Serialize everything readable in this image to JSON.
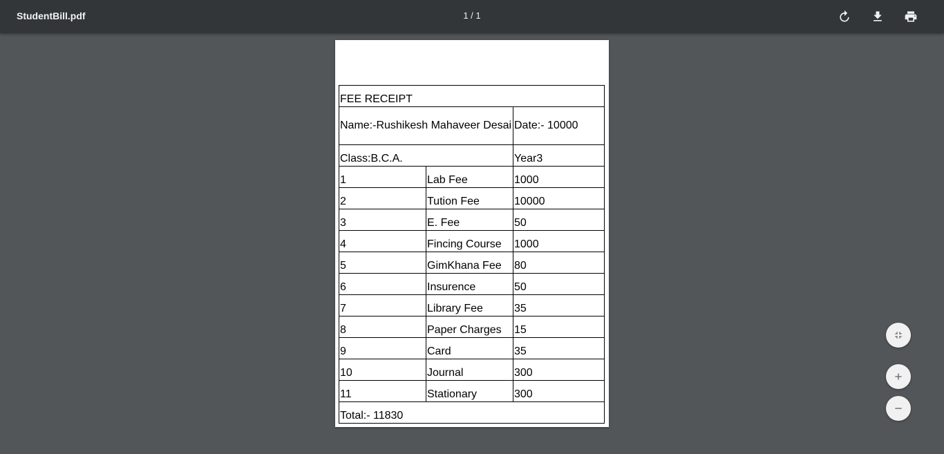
{
  "toolbar": {
    "file_name": "StudentBill.pdf",
    "page_indicator": "1 / 1",
    "icons": {
      "rotate": "rotate-icon",
      "download": "download-icon",
      "print": "print-icon"
    }
  },
  "receipt": {
    "title": "FEE RECEIPT",
    "name": "Name:-Rushikesh Mahaveer Desai",
    "date": "Date:- 10000",
    "class": "Class:B.C.A.",
    "year": "Year3",
    "items": [
      {
        "no": "1",
        "name": "Lab Fee",
        "amount": "1000"
      },
      {
        "no": "2",
        "name": "Tution Fee",
        "amount": "10000"
      },
      {
        "no": "3",
        "name": "E. Fee",
        "amount": "50"
      },
      {
        "no": "4",
        "name": "Fincing Course",
        "amount": "1000"
      },
      {
        "no": "5",
        "name": "GimKhana Fee",
        "amount": "80"
      },
      {
        "no": "6",
        "name": "Insurence",
        "amount": "50"
      },
      {
        "no": "7",
        "name": "Library Fee",
        "amount": "35"
      },
      {
        "no": "8",
        "name": "Paper Charges",
        "amount": "15"
      },
      {
        "no": "9",
        "name": "Card",
        "amount": "35"
      },
      {
        "no": "10",
        "name": "Journal",
        "amount": "300"
      },
      {
        "no": "11",
        "name": "Stationary",
        "amount": "300"
      }
    ],
    "total": "Total:- 11830"
  },
  "controls": {
    "icons": {
      "fit": "fit-to-page-icon",
      "zoom_in": "zoom-in-icon",
      "zoom_out": "zoom-out-icon"
    }
  },
  "colors": {
    "toolbar_bg": "#323639",
    "viewer_bg": "#525659",
    "page_bg": "#ffffff",
    "fab_bg": "#f1f1f1"
  }
}
